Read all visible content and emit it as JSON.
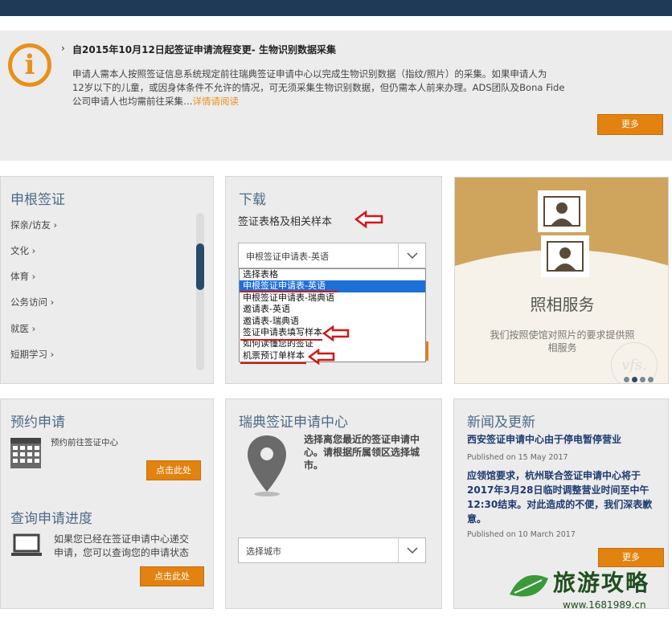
{
  "banner": {
    "title": "自2015年10月12日起签证申请流程变更- 生物识别数据采集",
    "line1": "申请人需本人按照签证信息系统规定前往瑞典签证申请中心以完成生物识别数据（指纹/照片）的采集。如果申请人为",
    "line2": "12岁以下的儿童，或因身体条件不允许的情况，可无须采集生物识别数据，但仍需本人前来办理。ADS团队及Bona Fide",
    "line3": "公司申请人也均需前往采集…",
    "link": "详情请阅读",
    "more_button": "更多"
  },
  "schengen": {
    "title": "申根签证",
    "items": [
      "探亲/访友",
      "文化",
      "体育",
      "公务访问",
      "就医",
      "短期学习"
    ]
  },
  "download": {
    "title": "下载",
    "subtitle": "签证表格及相关样本",
    "select_value": "申根签证申请表-英语",
    "options": [
      "选择表格",
      "申根签证申请表-英语",
      "申根签证申请表-瑞典语",
      "邀请表-英语",
      "邀请表-瑞典语",
      "签证申请表填写样本",
      "如何读懂您的签证",
      "机票预订单样本"
    ],
    "selected_index": 1
  },
  "photo": {
    "title": "照相服务",
    "desc_line1": "我们按照使馆对照片的要求提供照",
    "desc_line2": "相服务",
    "logo": "vfs.",
    "active_slide": 2
  },
  "appointment": {
    "title": "预约申请",
    "text": "预约前往签证中心",
    "button": "点击此处"
  },
  "tracking": {
    "title": "查询申请进度",
    "text_line1": "如果您已经在签证申请中心递交",
    "text_line2": "申请，您可以查询您的申请状态",
    "button": "点击此处"
  },
  "center": {
    "title": "瑞典签证申请中心",
    "text_line1": "选择离您最近的签证申请中",
    "text_line2": "心。请根据所属领区选择城",
    "text_line3": "市。",
    "select_value": "选择城市"
  },
  "news": {
    "title": "新闻及更新",
    "item1_title": "西安签证申请中心由于停电暂停营业",
    "item1_date": "Published on 15 May 2017",
    "item2_line1": "应领馆要求，杭州联合签证申请中心将于",
    "item2_line2": "2017年3月28日临时调整营业时间至中午",
    "item2_line3": "12:30结束。对此造成的不便，我们深表歉",
    "item2_line4": "意。",
    "item2_date": "Published on 10 March 2017",
    "more_button": "更多"
  },
  "watermark": {
    "name": "旅游攻略",
    "url": "www.1681989.cn"
  },
  "colors": {
    "accent": "#e2820f",
    "navy": "#1e3a57",
    "annotation_red": "#d01818"
  }
}
